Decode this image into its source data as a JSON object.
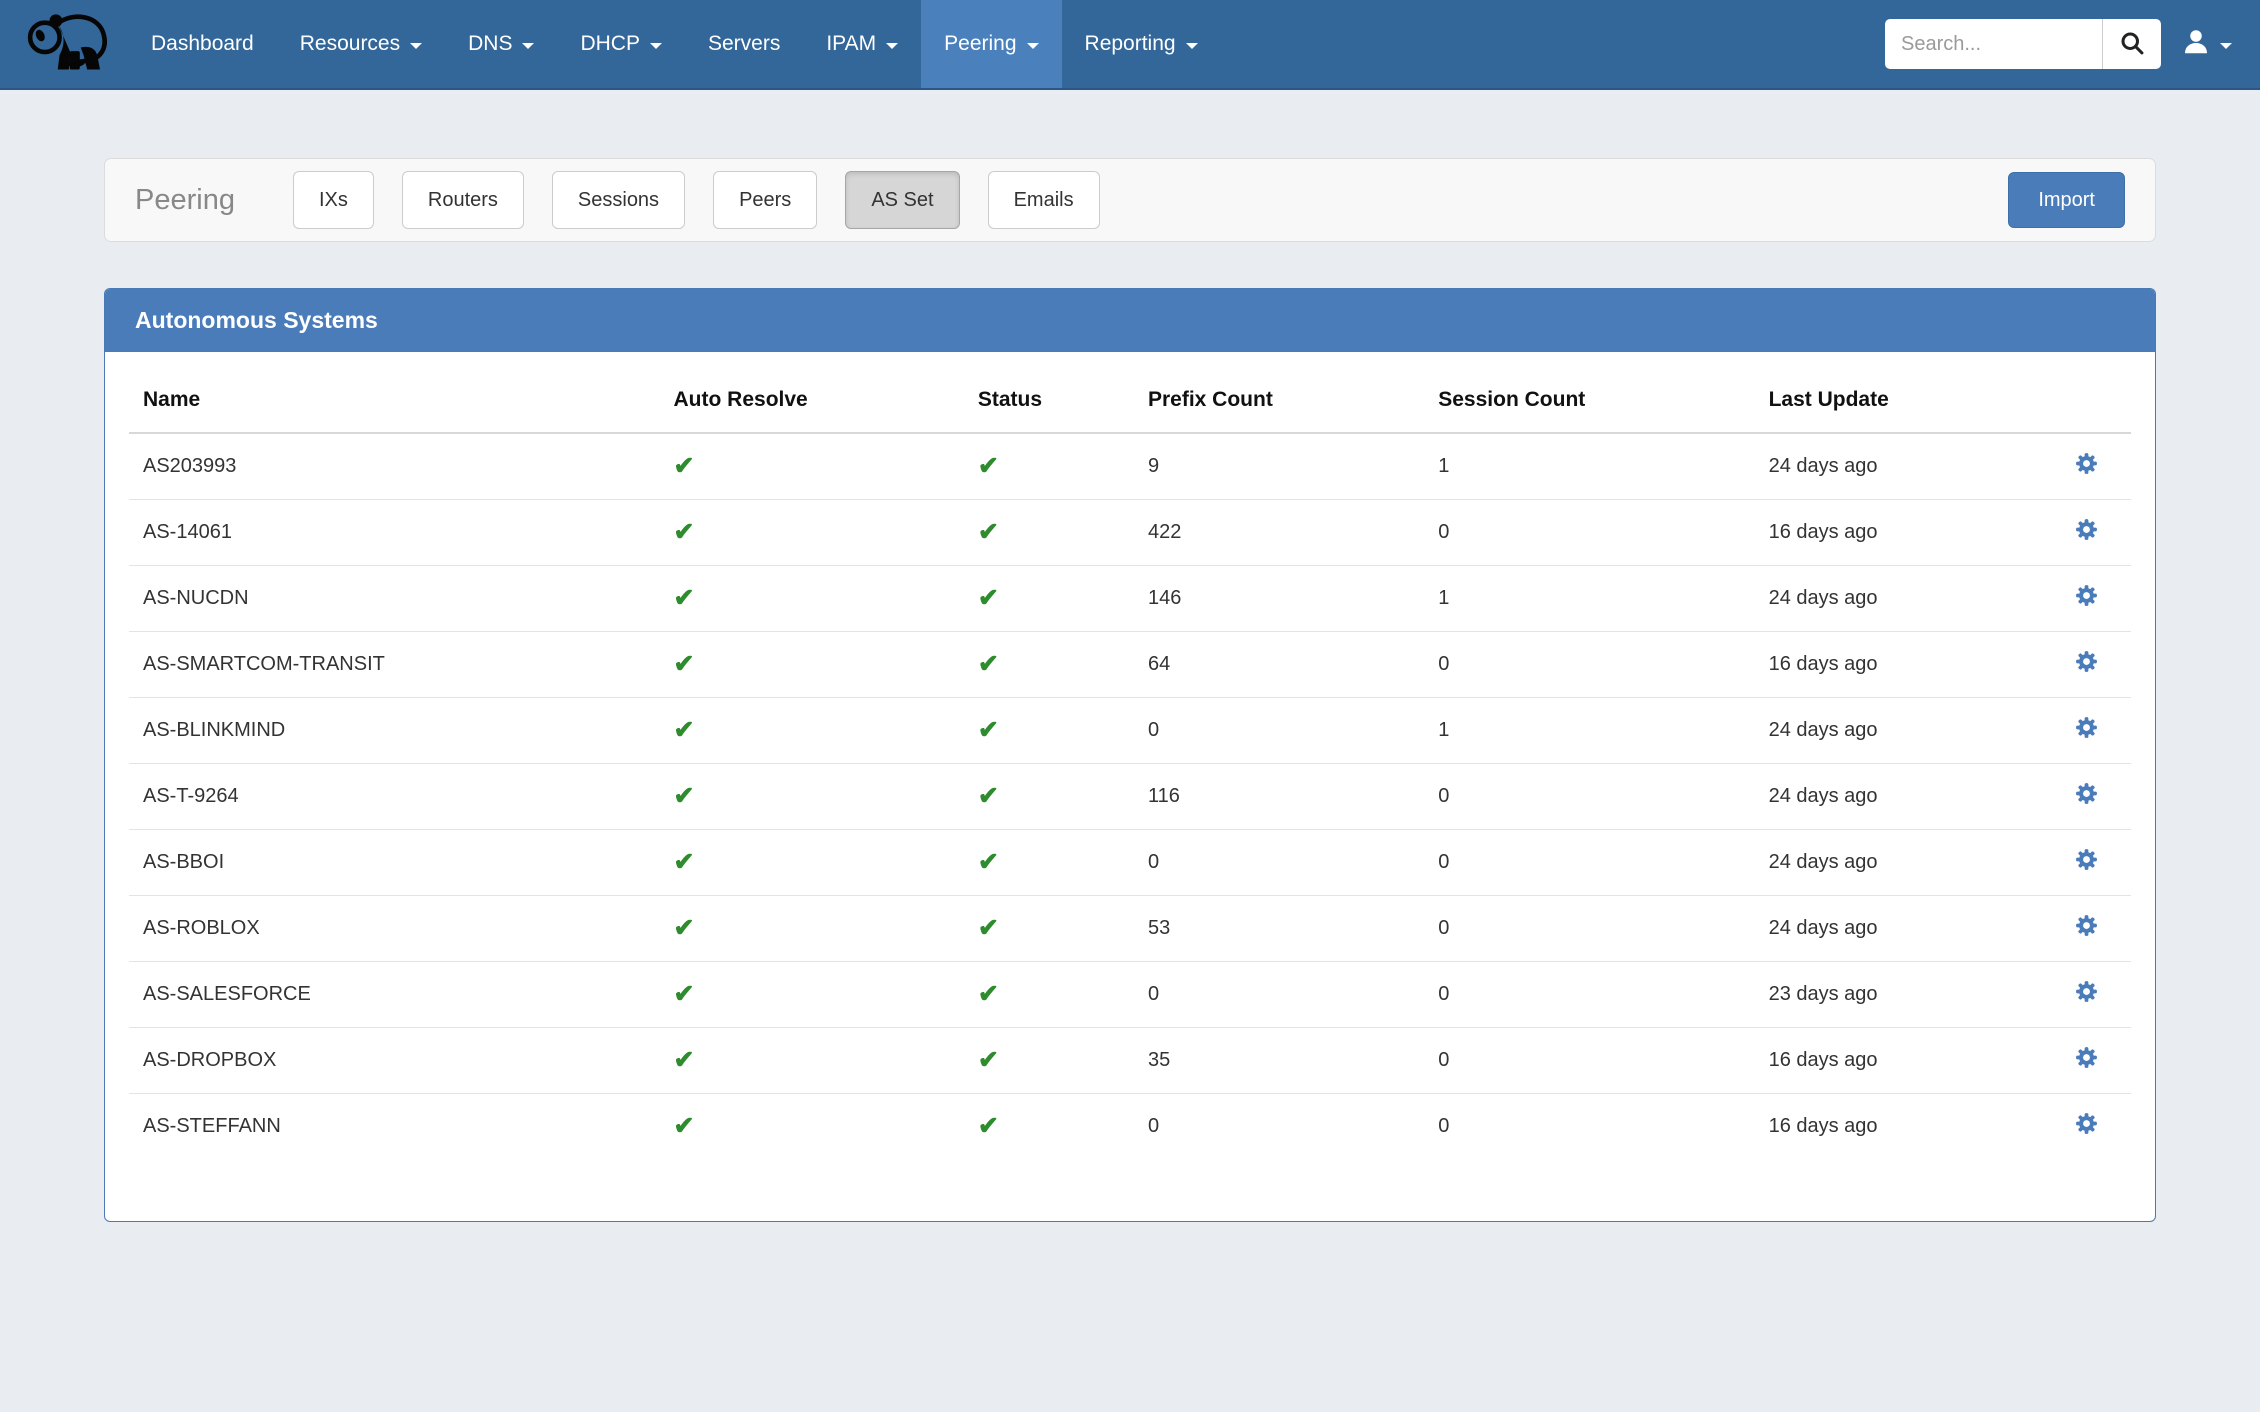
{
  "navbar": {
    "brand_icon": "panda-logo",
    "items": [
      {
        "label": "Dashboard",
        "dropdown": false,
        "active": false
      },
      {
        "label": "Resources",
        "dropdown": true,
        "active": false
      },
      {
        "label": "DNS",
        "dropdown": true,
        "active": false
      },
      {
        "label": "DHCP",
        "dropdown": true,
        "active": false
      },
      {
        "label": "Servers",
        "dropdown": false,
        "active": false
      },
      {
        "label": "IPAM",
        "dropdown": true,
        "active": false
      },
      {
        "label": "Peering",
        "dropdown": true,
        "active": true
      },
      {
        "label": "Reporting",
        "dropdown": true,
        "active": false
      }
    ],
    "search": {
      "placeholder": "Search...",
      "value": "",
      "icon": "search-icon"
    },
    "user_menu": {
      "icon": "user-icon",
      "dropdown_icon": "chevron-down-icon"
    }
  },
  "toolbar": {
    "title": "Peering",
    "buttons": [
      {
        "label": "IXs",
        "active": false
      },
      {
        "label": "Routers",
        "active": false
      },
      {
        "label": "Sessions",
        "active": false
      },
      {
        "label": "Peers",
        "active": false
      },
      {
        "label": "AS Set",
        "active": true
      },
      {
        "label": "Emails",
        "active": false
      }
    ],
    "import_label": "Import"
  },
  "table_panel": {
    "title": "Autonomous Systems",
    "columns": [
      "Name",
      "Auto Resolve",
      "Status",
      "Prefix Count",
      "Session Count",
      "Last Update"
    ],
    "row_action_icon": "gear-icon",
    "check_icon": "check-icon",
    "rows": [
      {
        "name": "AS203993",
        "auto_resolve": true,
        "status": true,
        "prefix_count": "9",
        "session_count": "1",
        "last_update": "24 days ago"
      },
      {
        "name": "AS-14061",
        "auto_resolve": true,
        "status": true,
        "prefix_count": "422",
        "session_count": "0",
        "last_update": "16 days ago"
      },
      {
        "name": "AS-NUCDN",
        "auto_resolve": true,
        "status": true,
        "prefix_count": "146",
        "session_count": "1",
        "last_update": "24 days ago"
      },
      {
        "name": "AS-SMARTCOM-TRANSIT",
        "auto_resolve": true,
        "status": true,
        "prefix_count": "64",
        "session_count": "0",
        "last_update": "16 days ago"
      },
      {
        "name": "AS-BLINKMIND",
        "auto_resolve": true,
        "status": true,
        "prefix_count": "0",
        "session_count": "1",
        "last_update": "24 days ago"
      },
      {
        "name": "AS-T-9264",
        "auto_resolve": true,
        "status": true,
        "prefix_count": "116",
        "session_count": "0",
        "last_update": "24 days ago"
      },
      {
        "name": "AS-BBOI",
        "auto_resolve": true,
        "status": true,
        "prefix_count": "0",
        "session_count": "0",
        "last_update": "24 days ago"
      },
      {
        "name": "AS-ROBLOX",
        "auto_resolve": true,
        "status": true,
        "prefix_count": "53",
        "session_count": "0",
        "last_update": "24 days ago"
      },
      {
        "name": "AS-SALESFORCE",
        "auto_resolve": true,
        "status": true,
        "prefix_count": "0",
        "session_count": "0",
        "last_update": "23 days ago"
      },
      {
        "name": "AS-DROPBOX",
        "auto_resolve": true,
        "status": true,
        "prefix_count": "35",
        "session_count": "0",
        "last_update": "16 days ago"
      },
      {
        "name": "AS-STEFFANN",
        "auto_resolve": true,
        "status": true,
        "prefix_count": "0",
        "session_count": "0",
        "last_update": "16 days ago"
      }
    ]
  },
  "colors": {
    "navbar_bg": "#336699",
    "navbar_active_bg": "#4a80bc",
    "panel_header_blue": "#4a7cba",
    "panel_border_blue": "#4a7ab5",
    "import_button_blue": "#4a7cba",
    "check_green": "#2e8b2e",
    "gear_blue": "#4a7cba",
    "page_bg": "#e9edf1",
    "toolbar_bg": "#f8f8f8",
    "active_button_gray": "#d6d6d6"
  }
}
